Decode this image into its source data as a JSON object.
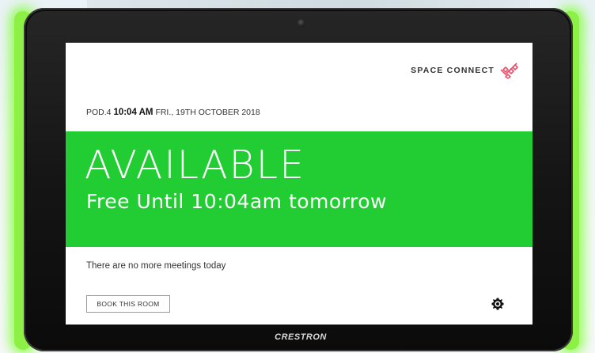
{
  "device": {
    "brand": "CRESTRON"
  },
  "app": {
    "logo_text": "SPACE CONNECT"
  },
  "header": {
    "room": "POD.4",
    "time": "10:04 AM",
    "date": "FRI., 19TH OCTOBER 2018"
  },
  "status": {
    "title": "AVAILABLE",
    "subtitle": "Free Until 10:04am tomorrow",
    "color": "#22cd34"
  },
  "meetings": {
    "message": "There are no more meetings today"
  },
  "actions": {
    "book_label": "BOOK THIS ROOM",
    "settings_icon": "gear-icon"
  },
  "colors": {
    "accent_logo": "#e9506e",
    "glow": "#8cf045"
  }
}
